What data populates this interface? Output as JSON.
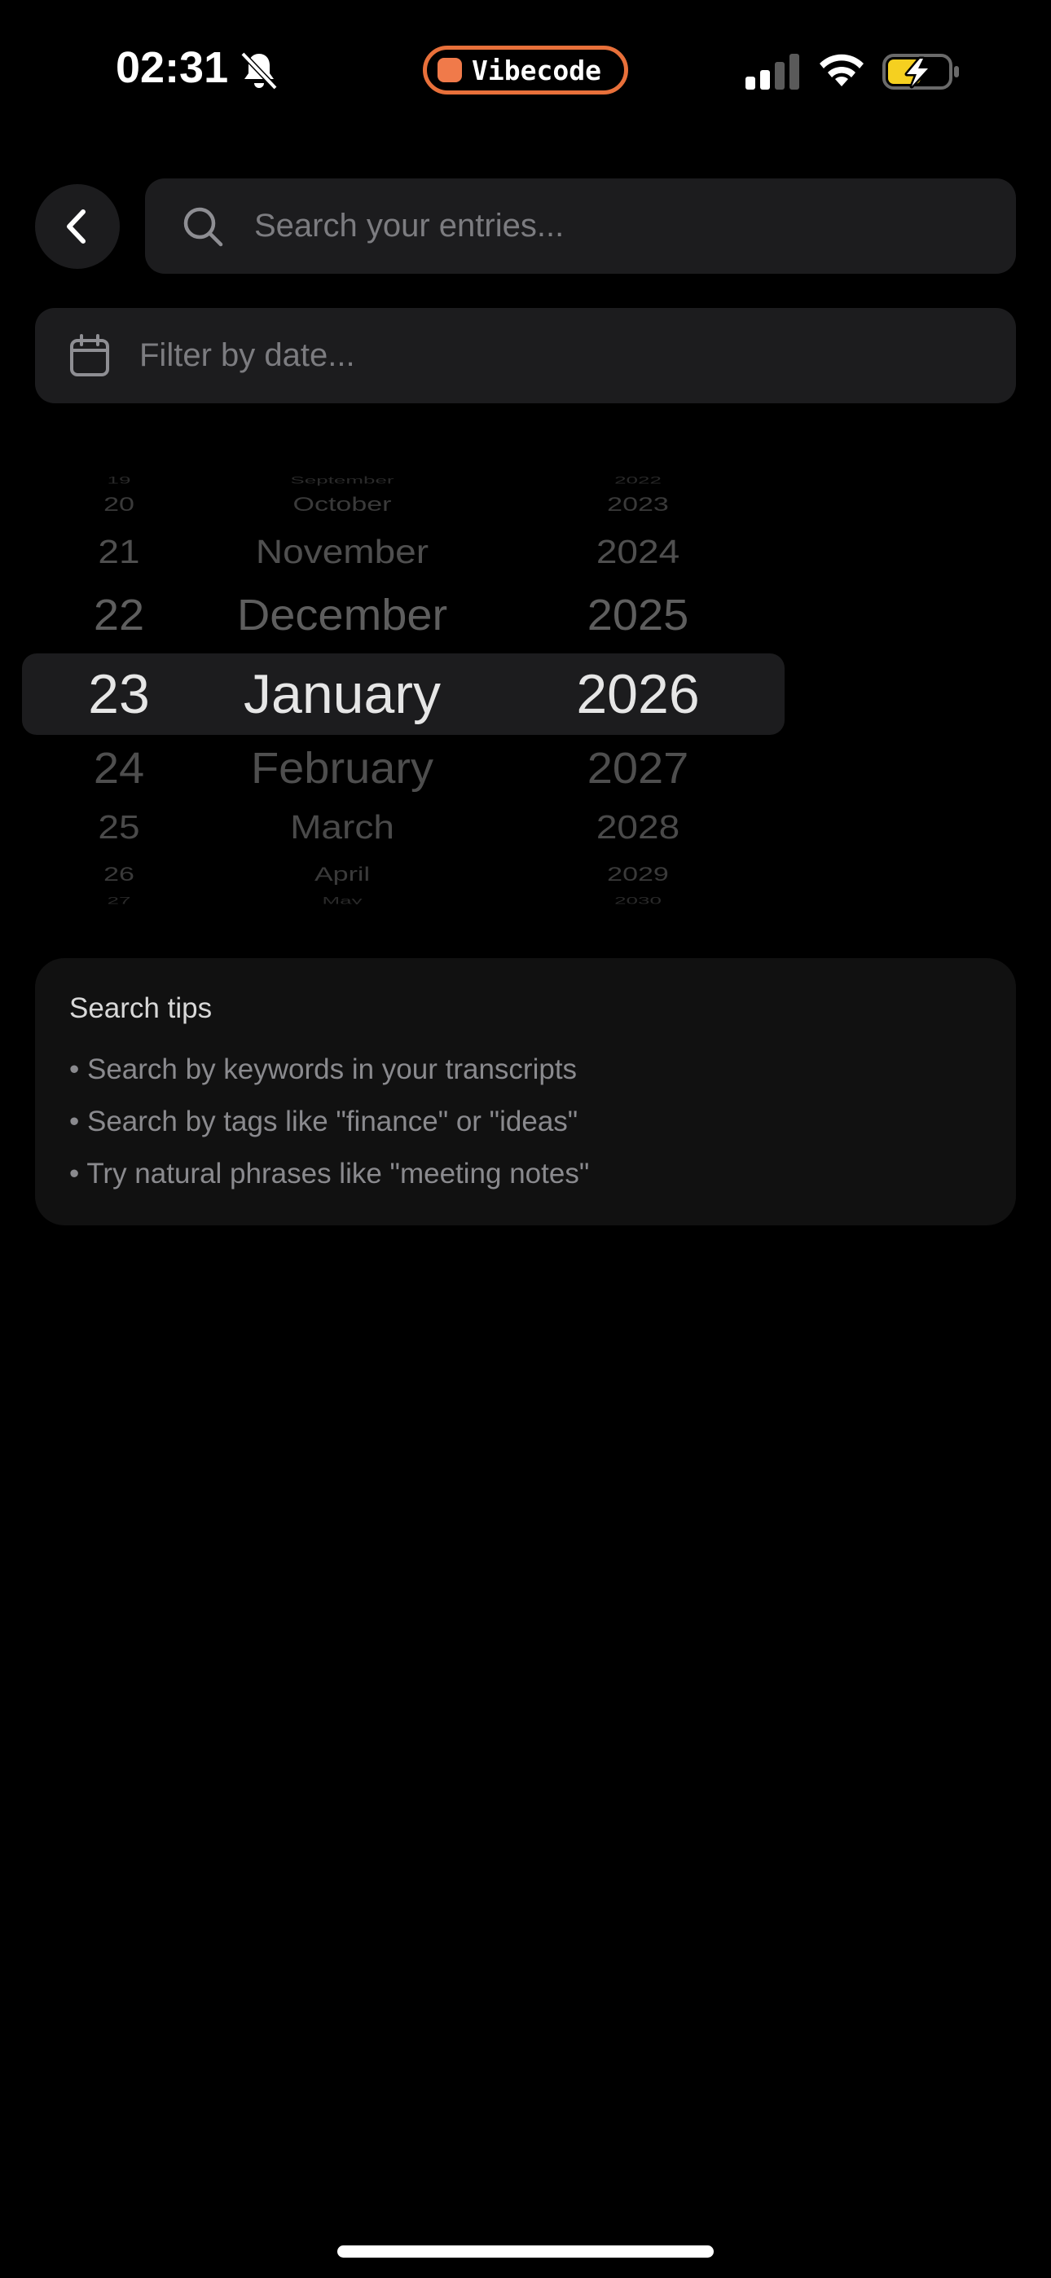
{
  "status_bar": {
    "time": "02:31",
    "app_badge": "Vibecode",
    "icons": [
      "bell-slash-icon",
      "cellular-signal-icon",
      "wifi-icon",
      "battery-charging-icon"
    ],
    "badge_color": "#e8703a",
    "battery_color": "#f5d020"
  },
  "header": {
    "back_icon": "chevron-left-icon",
    "search": {
      "placeholder": "Search your entries...",
      "value": ""
    }
  },
  "date_filter": {
    "placeholder": "Filter by date...",
    "icon": "calendar-icon"
  },
  "date_picker": {
    "selected": {
      "day": "23",
      "month": "January",
      "year": "2026"
    },
    "days": [
      "19",
      "20",
      "21",
      "22",
      "23",
      "24",
      "25",
      "26",
      "27"
    ],
    "months": [
      "September",
      "October",
      "November",
      "December",
      "January",
      "February",
      "March",
      "April",
      "May"
    ],
    "years": [
      "2022",
      "2023",
      "2024",
      "2025",
      "2026",
      "2027",
      "2028",
      "2029",
      "2030"
    ]
  },
  "tips": {
    "title": "Search tips",
    "items": [
      "• Search by keywords in your transcripts",
      "• Search by tags like \"finance\" or \"ideas\"",
      "• Try natural phrases like \"meeting notes\""
    ]
  }
}
